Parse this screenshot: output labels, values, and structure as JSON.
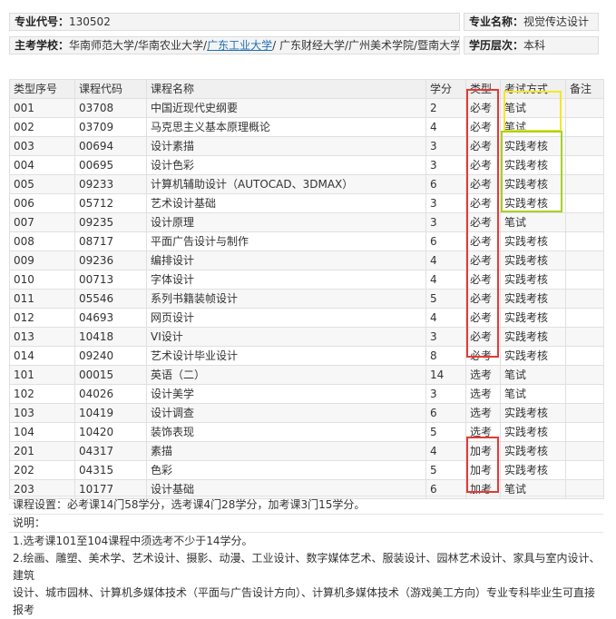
{
  "header": {
    "code_label": "专业代号：",
    "code": "130502",
    "name_label": "专业名称：",
    "name": "视觉传达设计",
    "schools_label": "主考学校：",
    "schools_pre": "华南师范大学/华南农业大学/",
    "schools_link": "广东工业大学",
    "schools_post": "/ 广东财经大学/广州美术学院/暨南大学",
    "level_label": "学历层次：",
    "level": "本科"
  },
  "table": {
    "columns": [
      "类型序号",
      "课程代码",
      "课程名称",
      "学分",
      "类型",
      "考试方式",
      "备注"
    ],
    "rows": [
      [
        "001",
        "03708",
        "中国近现代史纲要",
        "2",
        "必考",
        "笔试",
        ""
      ],
      [
        "002",
        "03709",
        "马克思主义基本原理概论",
        "4",
        "必考",
        "笔试",
        ""
      ],
      [
        "003",
        "00694",
        "设计素描",
        "3",
        "必考",
        "实践考核",
        ""
      ],
      [
        "004",
        "00695",
        "设计色彩",
        "3",
        "必考",
        "实践考核",
        ""
      ],
      [
        "005",
        "09233",
        "计算机辅助设计（AUTOCAD、3DMAX）",
        "6",
        "必考",
        "实践考核",
        ""
      ],
      [
        "006",
        "05712",
        "艺术设计基础",
        "3",
        "必考",
        "实践考核",
        ""
      ],
      [
        "007",
        "09235",
        "设计原理",
        "3",
        "必考",
        "笔试",
        ""
      ],
      [
        "008",
        "08717",
        "平面广告设计与制作",
        "6",
        "必考",
        "实践考核",
        ""
      ],
      [
        "009",
        "09236",
        "编排设计",
        "4",
        "必考",
        "实践考核",
        ""
      ],
      [
        "010",
        "00713",
        "字体设计",
        "4",
        "必考",
        "实践考核",
        ""
      ],
      [
        "011",
        "05546",
        "系列书籍装帧设计",
        "5",
        "必考",
        "实践考核",
        ""
      ],
      [
        "012",
        "04693",
        "网页设计",
        "4",
        "必考",
        "实践考核",
        ""
      ],
      [
        "013",
        "10418",
        "VI设计",
        "3",
        "必考",
        "实践考核",
        ""
      ],
      [
        "014",
        "09240",
        "艺术设计毕业设计",
        "8",
        "必考",
        "实践考核",
        ""
      ],
      [
        "101",
        "00015",
        "英语（二）",
        "14",
        "选考",
        "笔试",
        ""
      ],
      [
        "102",
        "04026",
        "设计美学",
        "3",
        "选考",
        "笔试",
        ""
      ],
      [
        "103",
        "10419",
        "设计调查",
        "6",
        "选考",
        "实践考核",
        ""
      ],
      [
        "104",
        "10420",
        "装饰表现",
        "5",
        "选考",
        "实践考核",
        ""
      ],
      [
        "201",
        "04317",
        "素描",
        "4",
        "加考",
        "实践考核",
        ""
      ],
      [
        "202",
        "04315",
        "色彩",
        "5",
        "加考",
        "实践考核",
        ""
      ],
      [
        "203",
        "10177",
        "设计基础",
        "6",
        "加考",
        "笔试",
        ""
      ]
    ]
  },
  "notes": {
    "summary": "课程设置：必考课14门58学分，选考课4门28学分，加考课3门15学分。",
    "title": "说明：",
    "line1": "1.选考课101至104课程中须选考不少于14学分。",
    "line2": "2.绘画、雕塑、美术学、艺术设计、摄影、动漫、工业设计、数字媒体艺术、服装设计、园林艺术设计、家具与室内设计、建筑",
    "line3": "设计、城市园林、计算机多媒体技术（平面与广告设计方向）、计算机多媒体技术（游戏美工方向）专业专科毕业生可直接报考"
  },
  "colors": {
    "red": "#e53935",
    "yellow": "#f5e62b",
    "green": "#a6d21e",
    "link": "#1f6fb5"
  }
}
